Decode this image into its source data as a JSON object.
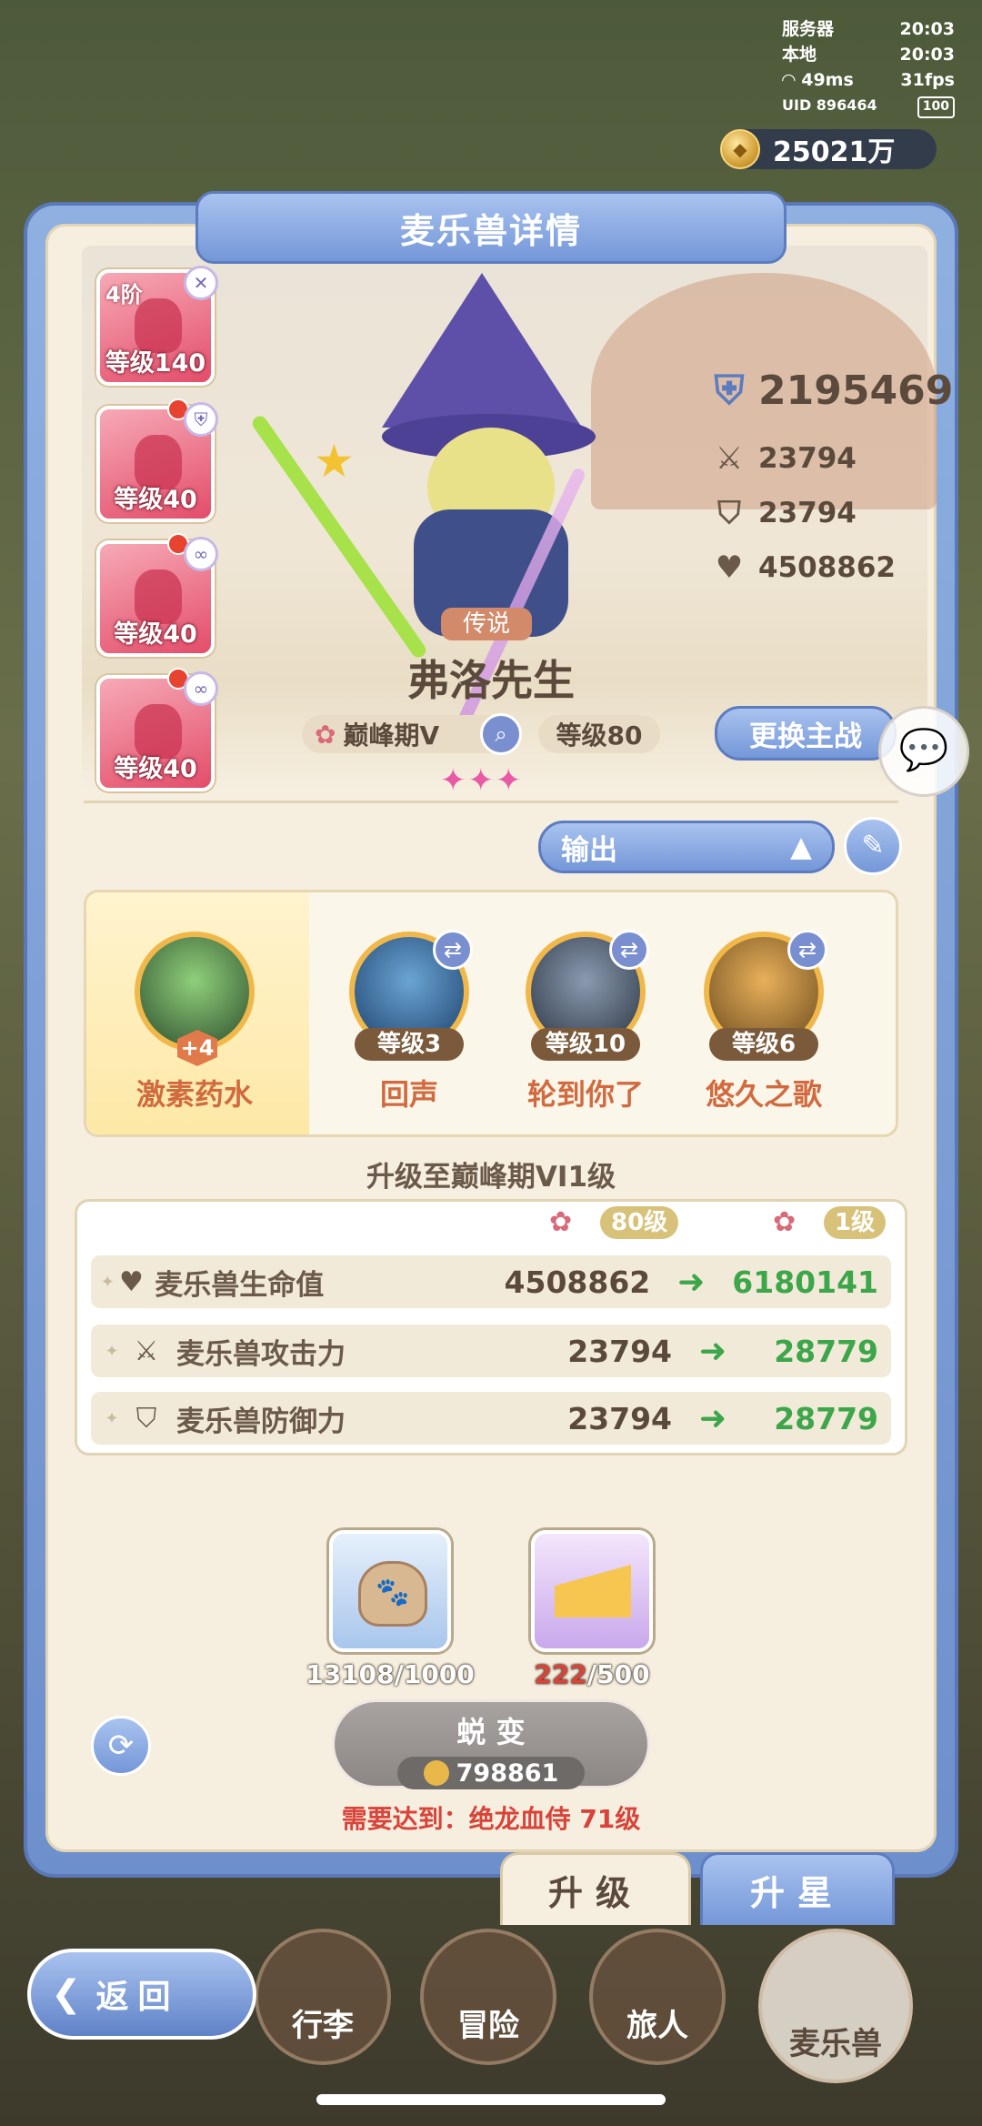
{
  "status": {
    "server_label": "服务器",
    "server_time": "20:03",
    "local_label": "本地",
    "local_time": "20:03",
    "ping": "49ms",
    "fps": "31fps",
    "uid": "UID 896464",
    "battery": "100"
  },
  "currency": {
    "amount": "25021万"
  },
  "panel": {
    "title": "麦乐兽详情"
  },
  "skill_cards": [
    {
      "tag": "4阶",
      "level": "等级140",
      "badge": "close"
    },
    {
      "level": "等级40",
      "badge": "shield"
    },
    {
      "level": "等级40",
      "badge": "link"
    },
    {
      "level": "等级40",
      "badge": "link"
    }
  ],
  "character": {
    "rarity": "传说",
    "name": "弗洛先生",
    "stage": "巅峰期V",
    "level": "等级80",
    "stars": "✦✦✦",
    "power": "2195469",
    "attack": "23794",
    "defense": "23794",
    "hp": "4508862",
    "switch_button": "更换主战"
  },
  "role_select": {
    "value": "输出"
  },
  "skills": [
    {
      "name": "激素药水",
      "badge": "+4"
    },
    {
      "name": "回声",
      "level": "等级3"
    },
    {
      "name": "轮到你了",
      "level": "等级10"
    },
    {
      "name": "悠久之歌",
      "level": "等级6"
    }
  ],
  "upgrade": {
    "title": "升级至巅峰期VI1级",
    "from_level": "80级",
    "to_level": "1级",
    "rows": [
      {
        "label": "麦乐兽生命值",
        "old": "4508862",
        "new": "6180141",
        "icon": "heart-icon"
      },
      {
        "label": "麦乐兽攻击力",
        "old": "23794",
        "new": "28779",
        "icon": "swords-icon"
      },
      {
        "label": "麦乐兽防御力",
        "old": "23794",
        "new": "28779",
        "icon": "shield-icon"
      }
    ]
  },
  "materials": [
    {
      "have": "13108",
      "need": "/1000",
      "icon": "food-bag-icon"
    },
    {
      "have": "222",
      "need": "/500",
      "icon": "cheese-icon"
    }
  ],
  "evolve": {
    "label": "蜕 变",
    "cost": "798861",
    "requirement": "需要达到：绝龙血侍 71级"
  },
  "tabs": {
    "upgrade": "升级",
    "star": "升星"
  },
  "nav": {
    "back": "返回",
    "items": [
      "行李",
      "冒险",
      "旅人",
      "麦乐兽"
    ]
  },
  "colors": {
    "accent_blue": "#7497d8",
    "green": "#3da64a",
    "red": "#d8443a"
  }
}
